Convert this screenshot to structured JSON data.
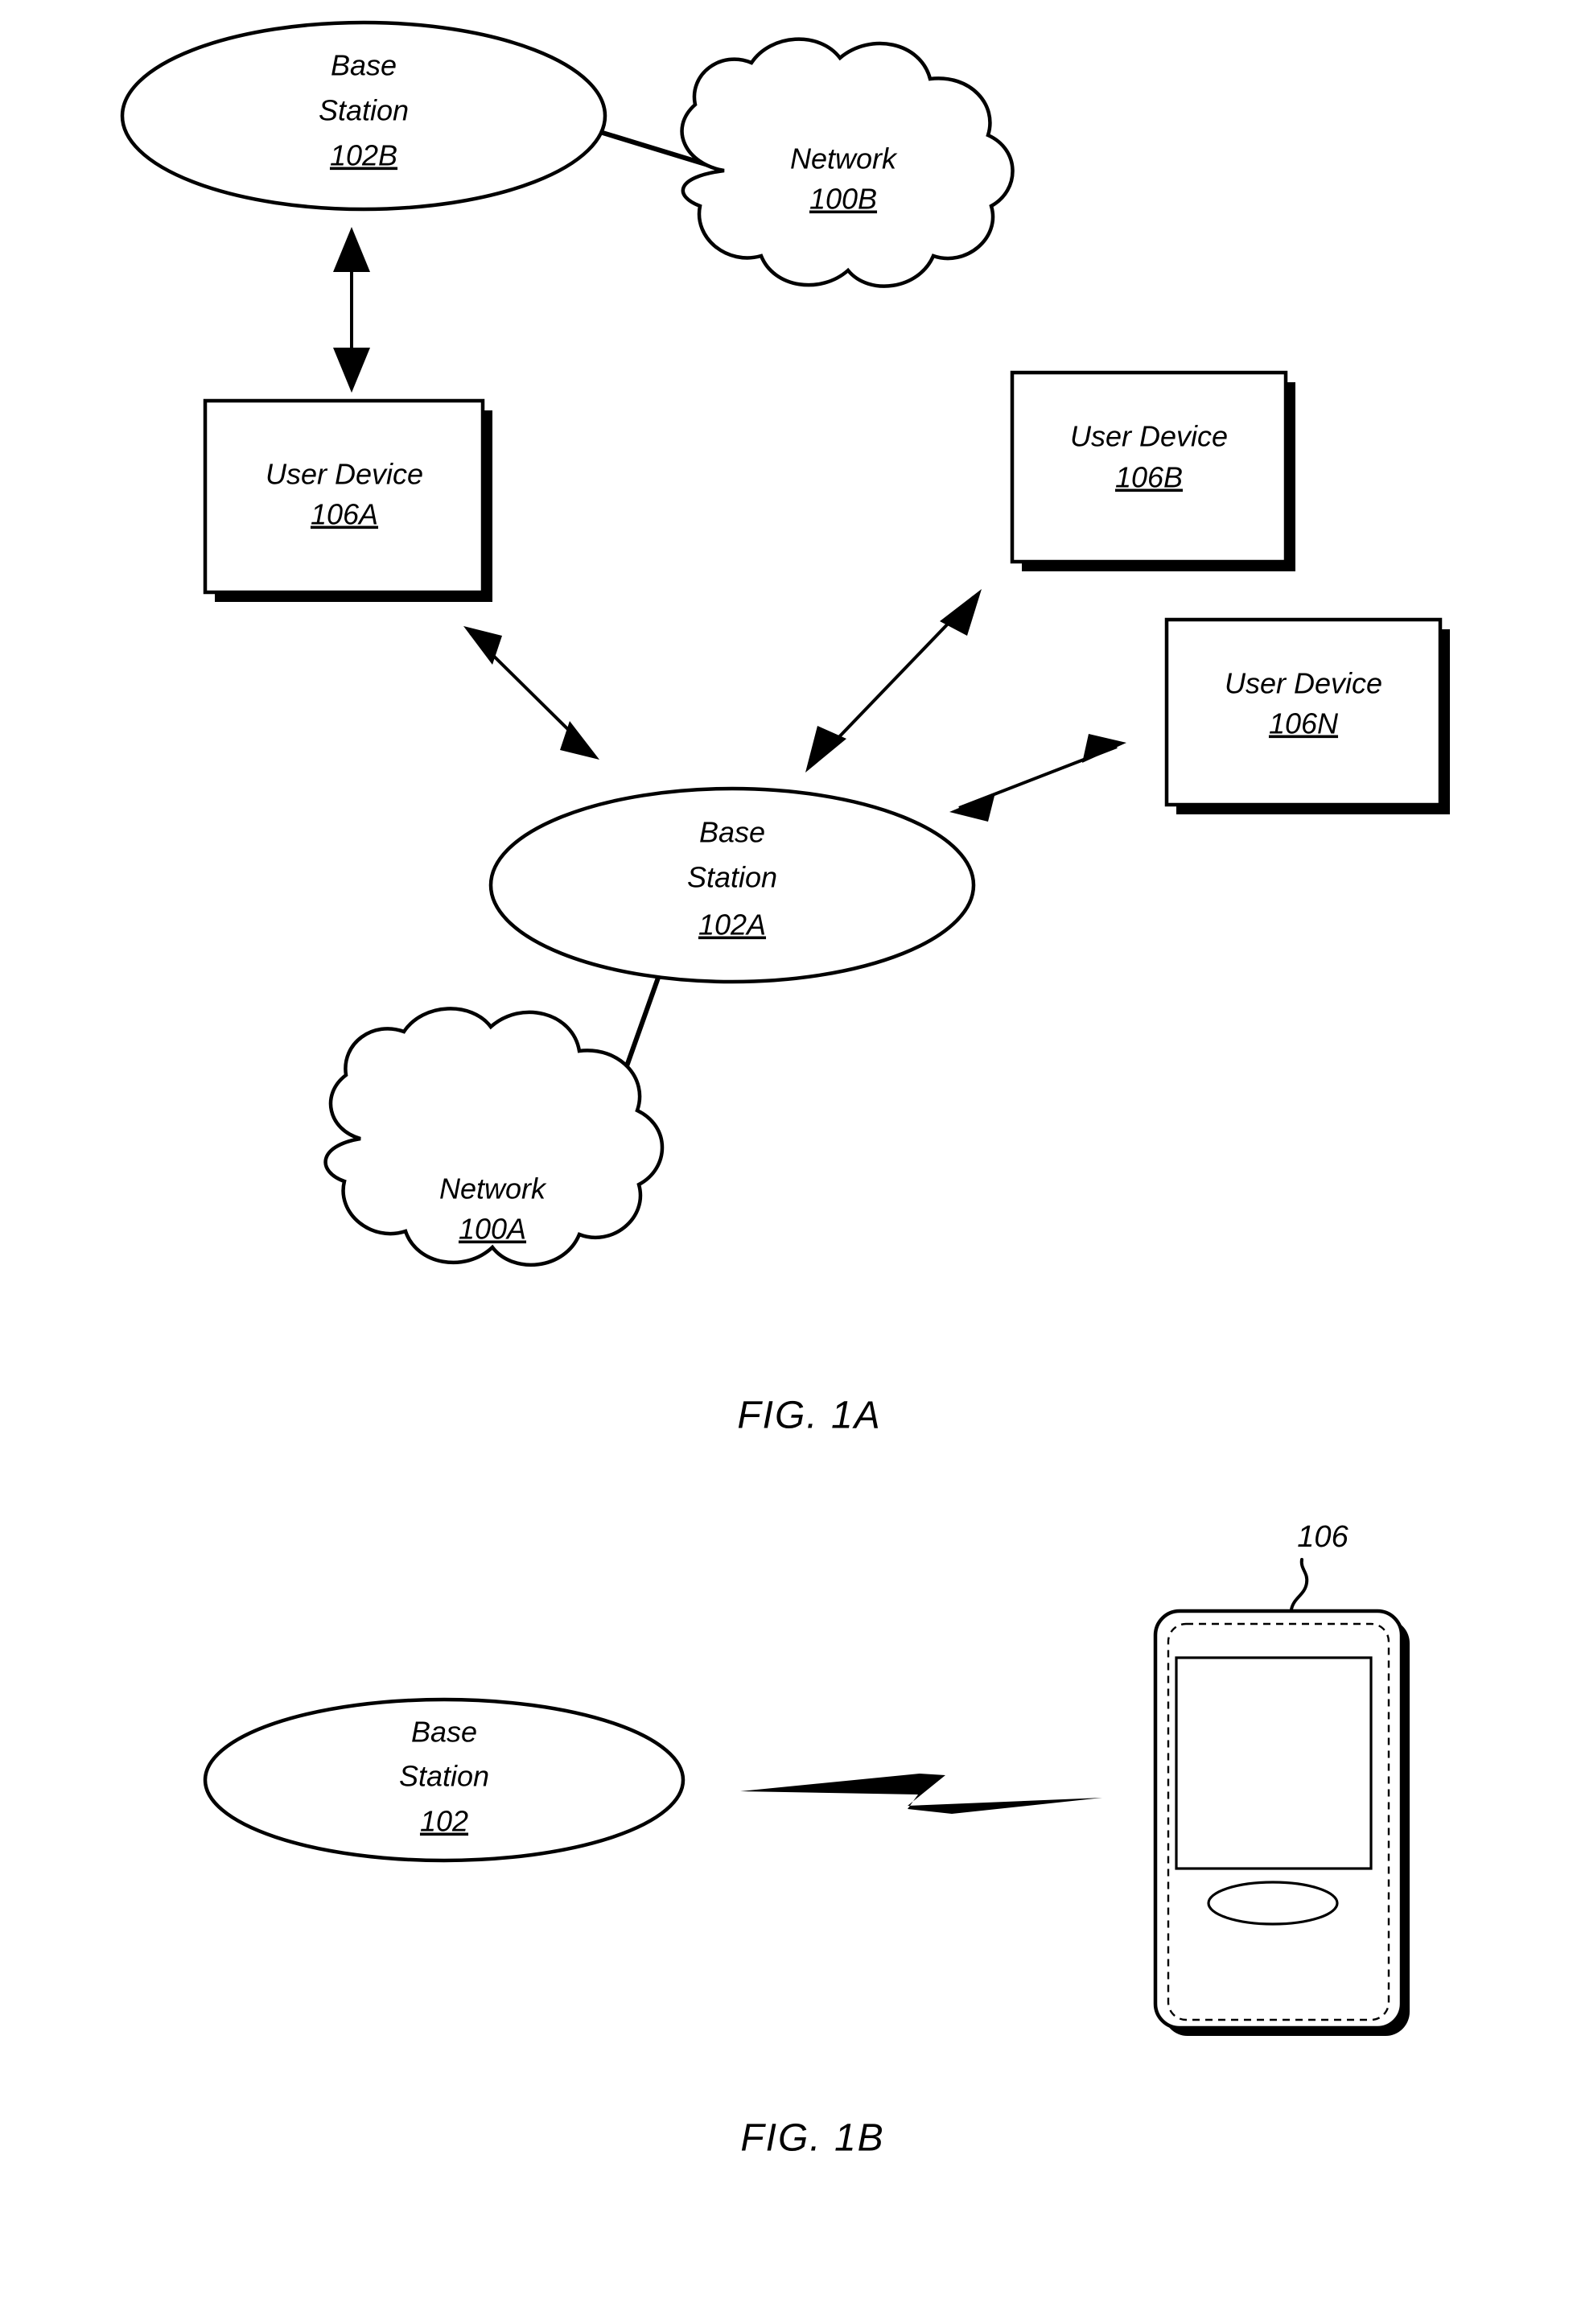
{
  "document": {
    "kind": "patent-figure-sheet",
    "figures": [
      {
        "id": "fig-1a",
        "caption": "FIG. 1A"
      },
      {
        "id": "fig-1b",
        "caption": "FIG. 1B"
      }
    ]
  },
  "fig1a": {
    "caption": "FIG. 1A",
    "nodes": {
      "base_station_b": {
        "line1": "Base",
        "line2": "Station",
        "ref": "102B",
        "shape": "ellipse"
      },
      "network_b": {
        "line1": "Network",
        "ref": "100B",
        "shape": "cloud"
      },
      "user_device_a": {
        "line1": "User Device",
        "ref": "106A",
        "shape": "box"
      },
      "user_device_b": {
        "line1": "User Device",
        "ref": "106B",
        "shape": "box"
      },
      "user_device_n": {
        "line1": "User Device",
        "ref": "106N",
        "shape": "box"
      },
      "base_station_a": {
        "line1": "Base",
        "line2": "Station",
        "ref": "102A",
        "shape": "ellipse"
      },
      "network_a": {
        "line1": "Network",
        "ref": "100A",
        "shape": "cloud"
      }
    },
    "connections": [
      {
        "from": "base_station_b",
        "to": "network_b",
        "style": "plain-line"
      },
      {
        "from": "base_station_b",
        "to": "user_device_a",
        "style": "double-arrow"
      },
      {
        "from": "user_device_a",
        "to": "base_station_a",
        "style": "double-arrow"
      },
      {
        "from": "base_station_a",
        "to": "user_device_b",
        "style": "double-arrow"
      },
      {
        "from": "base_station_a",
        "to": "user_device_n",
        "style": "double-arrow"
      },
      {
        "from": "base_station_a",
        "to": "network_a",
        "style": "plain-line"
      }
    ]
  },
  "fig1b": {
    "caption": "FIG. 1B",
    "nodes": {
      "base_station": {
        "line1": "Base",
        "line2": "Station",
        "ref": "102",
        "shape": "ellipse"
      },
      "user_device": {
        "ref": "106",
        "shape": "mobile-phone"
      }
    },
    "connections": [
      {
        "from": "base_station",
        "to": "user_device",
        "style": "lightning-bolt"
      }
    ]
  },
  "colors": {
    "ink": "#000000",
    "paper": "#ffffff"
  }
}
